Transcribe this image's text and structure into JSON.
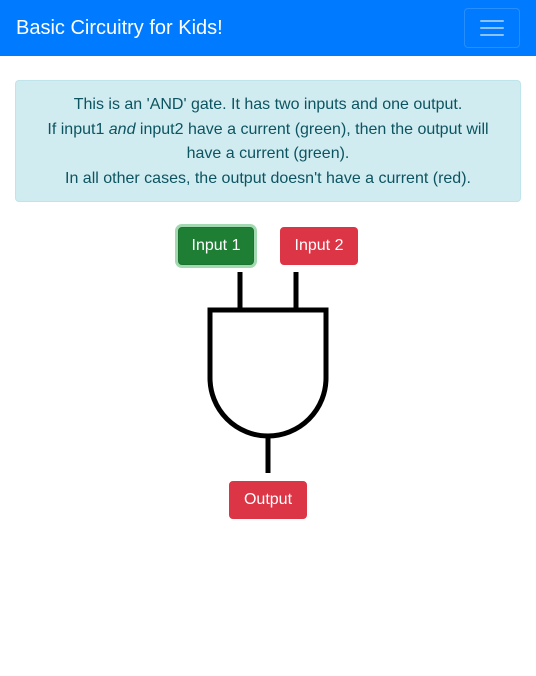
{
  "navbar": {
    "brand": "Basic Circuitry for Kids!",
    "brand_color": "#007bff",
    "toggler_icon": "hamburger-menu-icon"
  },
  "info": {
    "line1": "This is an 'AND' gate. It has two inputs and one output.",
    "line2_before": "If input1 ",
    "line2_emphasis": "and",
    "line2_after": " input2 have a current (green), then the output will have a current (green).",
    "line3": "In all other cases, the output doesn't have a current (red)."
  },
  "gate": {
    "type": "AND",
    "inputs": [
      {
        "label": "Input 1",
        "state": "on",
        "color": "#1e7e34"
      },
      {
        "label": "Input 2",
        "state": "off",
        "color": "#dc3545"
      }
    ],
    "output": {
      "label": "Output",
      "state": "off",
      "color": "#dc3545"
    }
  }
}
